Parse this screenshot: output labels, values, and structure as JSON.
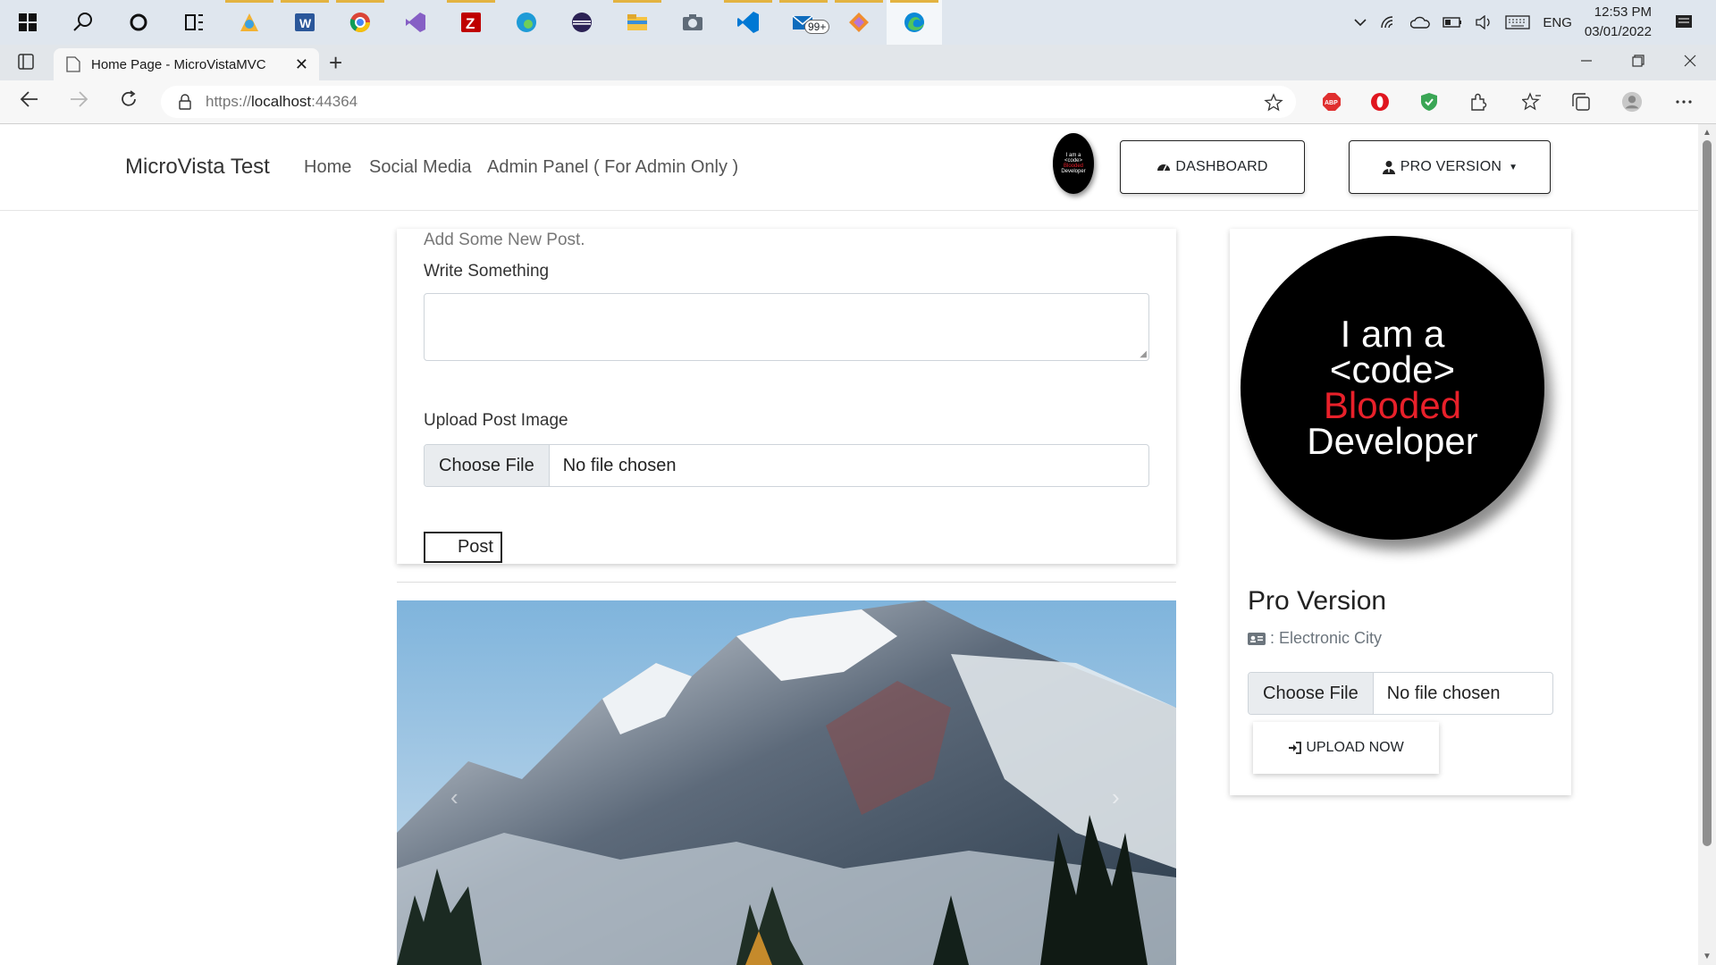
{
  "taskbar": {
    "icons": [
      "windows-start-icon",
      "search-icon",
      "cortana-icon",
      "task-view-icon",
      "paint-icon",
      "word-icon",
      "chrome-icon",
      "visual-studio-icon",
      "filezilla-icon",
      "edge-dev-icon",
      "eclipse-icon",
      "file-explorer-icon",
      "camera-icon",
      "vscode-icon",
      "mail-icon",
      "game-icon",
      "edge-icon"
    ],
    "mail_badge": "99+",
    "tray": {
      "language": "ENG",
      "time": "12:53 PM",
      "date": "03/01/2022"
    }
  },
  "browser": {
    "tab_title": "Home Page - MicroVistaMVC",
    "url_scheme": "https://",
    "url_host": "localhost",
    "url_port": ":44364",
    "new_tab": "+",
    "tab_close": "✕",
    "extensions": [
      "adblock-icon",
      "opera-icon",
      "shield-icon",
      "extensions-icon",
      "favorites-icon",
      "collections-icon",
      "profile-icon",
      "more-icon"
    ]
  },
  "site": {
    "brand": "MicroVista Test",
    "nav": [
      "Home",
      "Social Media",
      "Admin Panel ( For Admin Only )"
    ],
    "dashboard_label": "DASHBOARD",
    "pro_label": "PRO VERSION"
  },
  "post_form": {
    "heading": "Add Some New Post.",
    "write_label": "Write Something",
    "textarea_value": "",
    "upload_label": "Upload Post Image",
    "choose_file": "Choose File",
    "file_status": "No file chosen",
    "post_button": "Post"
  },
  "carousel": {
    "prev": "‹",
    "next": "›"
  },
  "profile": {
    "logo_lines": [
      "I am a",
      "<code>",
      "Blooded",
      "Developer"
    ],
    "name": "Pro Version",
    "location": ": Electronic City",
    "choose_file": "Choose File",
    "file_status": "No file chosen",
    "upload_button": "UPLOAD NOW"
  },
  "colors": {
    "taskbar": "#dfe6ee",
    "accent_red": "#e8202a",
    "text_muted": "#6c757d"
  }
}
